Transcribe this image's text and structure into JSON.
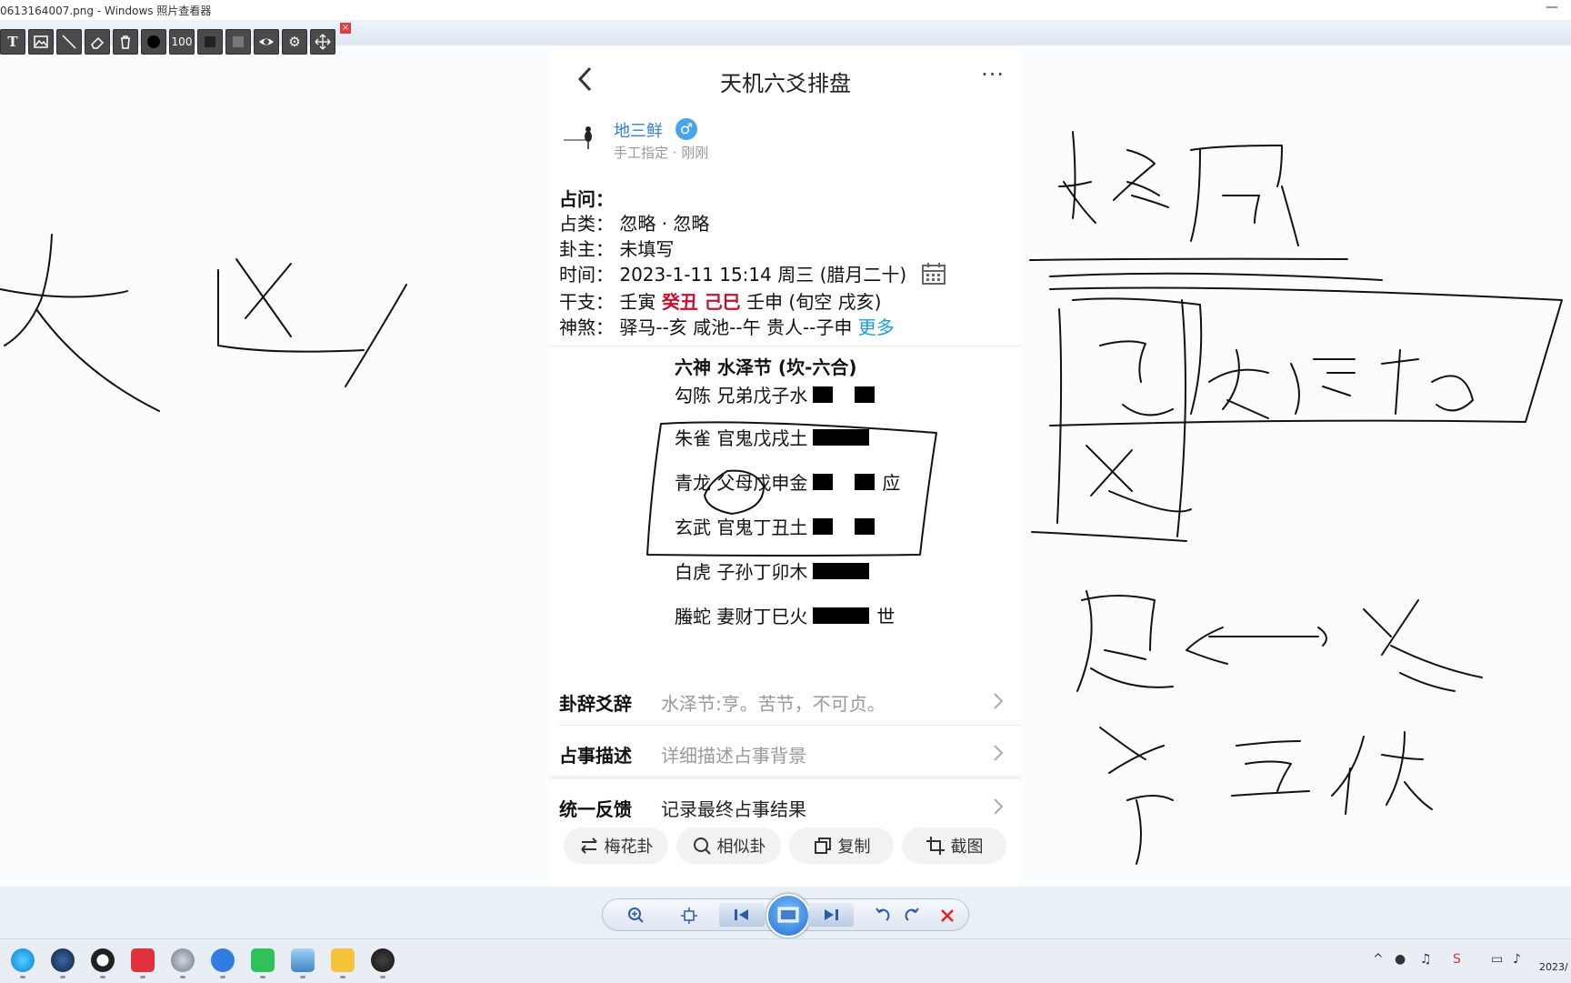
{
  "window": {
    "title": "0613164007.png - Windows 照片查看器",
    "minimize": "—"
  },
  "draw_toolbar": {
    "zoom_value": "100",
    "close": "×"
  },
  "app": {
    "title": "天机六爻排盘",
    "user": {
      "name": "地三鲜",
      "gender": "♂",
      "meta": "手工指定 · 刚刚"
    },
    "question_label": "占问：",
    "category": {
      "label": "占类：",
      "value": "忽略 · 忽略"
    },
    "owner": {
      "label": "卦主：",
      "value": "未填写"
    },
    "time": {
      "label": "时间：",
      "value": "2023-1-11 15:14 周三 (腊月二十)"
    },
    "ganzhi": {
      "label": "干支：",
      "part1": "壬寅",
      "part2": "癸丑 己巳",
      "part3": "壬申 (旬空 戌亥)"
    },
    "shensha": {
      "label": "神煞：",
      "value": "驿马--亥  咸池--午  贵人--子申",
      "more": "更多"
    },
    "hexagram": {
      "title": "六神  水泽节 (坎-六合)",
      "lines": [
        {
          "text": "勾陈 兄弟戊子水",
          "type": "yin",
          "mark": ""
        },
        {
          "text": "朱雀 官鬼戊戌土",
          "type": "yang",
          "mark": ""
        },
        {
          "text": "青龙 父母戊申金",
          "type": "yin",
          "mark": "应"
        },
        {
          "text": "玄武 官鬼丁丑土",
          "type": "yin",
          "mark": ""
        },
        {
          "text": "白虎 子孙丁卯木",
          "type": "yang",
          "mark": ""
        },
        {
          "text": "螣蛇 妻财丁巳火",
          "type": "yang",
          "mark": "世"
        }
      ]
    },
    "rows": [
      {
        "label": "卦辞爻辞",
        "value": "水泽节:亨。苦节，不可贞。"
      },
      {
        "label": "占事描述",
        "value": "详细描述占事背景"
      },
      {
        "label": "统一反馈",
        "value": "记录最终占事结果"
      }
    ],
    "actions": [
      {
        "label": "梅花卦",
        "icon": "swap-icon"
      },
      {
        "label": "相似卦",
        "icon": "search-icon"
      },
      {
        "label": "复制",
        "icon": "copy-icon"
      },
      {
        "label": "截图",
        "icon": "crop-icon"
      }
    ]
  },
  "taskbar": {
    "clock": "2023/"
  }
}
